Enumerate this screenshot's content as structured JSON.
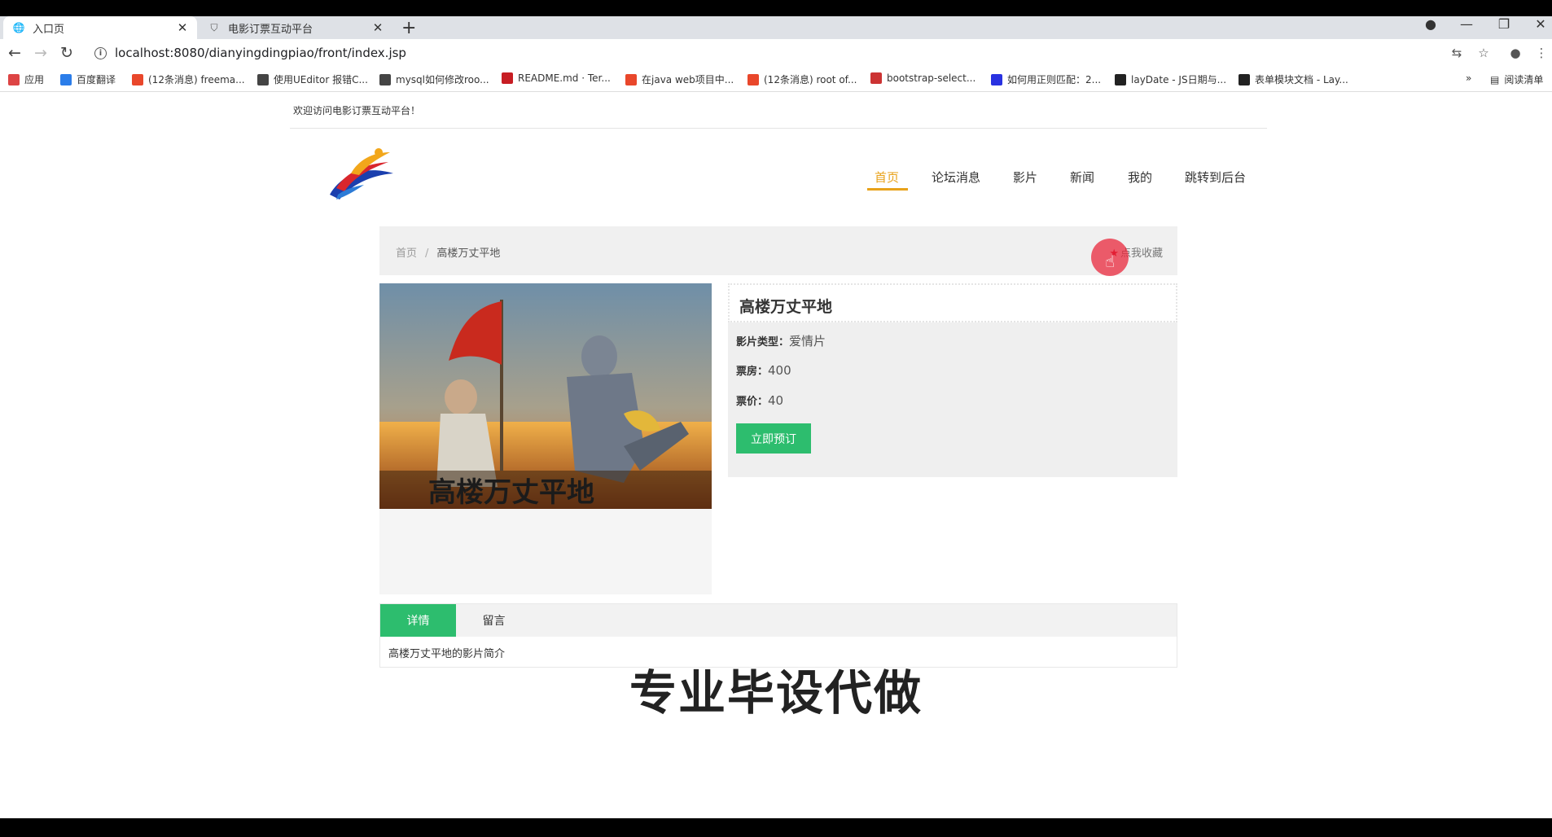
{
  "browser": {
    "tabs": [
      {
        "title": "入口页",
        "icon": "globe-icon",
        "active": true
      },
      {
        "title": "电影订票互动平台",
        "icon": "shield-icon",
        "active": false
      }
    ],
    "new_tab": "+",
    "url": "localhost:8080/dianyingdingpiao/front/index.jsp",
    "bookmarks": [
      {
        "label": "应用",
        "icon": "apps-grid-icon",
        "color": "#d44"
      },
      {
        "label": "百度翻译",
        "icon": "translate-icon",
        "color": "#2b7de9"
      },
      {
        "label": "(12条消息) freema...",
        "icon": "csdn-icon",
        "color": "#e9472b"
      },
      {
        "label": "使用UEditor 报错C...",
        "icon": "bookmark-icon",
        "color": "#444"
      },
      {
        "label": "mysql如何修改roo...",
        "icon": "bookmark-icon",
        "color": "#444"
      },
      {
        "label": "README.md · Ter...",
        "icon": "gitee-icon",
        "color": "#c71d23"
      },
      {
        "label": "在java web项目中...",
        "icon": "csdn-icon",
        "color": "#e9472b"
      },
      {
        "label": "(12条消息) root of...",
        "icon": "csdn-icon",
        "color": "#e9472b"
      },
      {
        "label": "bootstrap-select...",
        "icon": "bookmark-icon",
        "color": "#c33"
      },
      {
        "label": "如何用正则匹配：2...",
        "icon": "baidu-icon",
        "color": "#2932e1"
      },
      {
        "label": "layDate - JS日期与...",
        "icon": "layui-icon",
        "color": "#222"
      },
      {
        "label": "表单模块文档 - Lay...",
        "icon": "layui-icon",
        "color": "#222"
      }
    ],
    "more": "»",
    "reading_list": "阅读清单"
  },
  "page": {
    "welcome": "欢迎访问电影订票互动平台！",
    "nav": [
      "首页",
      "论坛消息",
      "影片",
      "新闻",
      "我的",
      "跳转到后台"
    ],
    "breadcrumb": {
      "home": "首页",
      "sep": "/",
      "current": "高楼万丈平地"
    },
    "favorite": "点我收藏",
    "movie": {
      "title": "高楼万丈平地",
      "type_label": "影片类型：",
      "type": "爱情片",
      "box_office_label": "票房：",
      "box_office": "400",
      "price_label": "票价：",
      "price": "40",
      "book": "立即预订"
    },
    "tabs": [
      "详情",
      "留言"
    ],
    "detail": "高楼万丈平地的影片简介"
  },
  "watermark": "专业毕设代做",
  "colors": {
    "accent": "#e8a21a",
    "green": "#2dbd6e"
  }
}
